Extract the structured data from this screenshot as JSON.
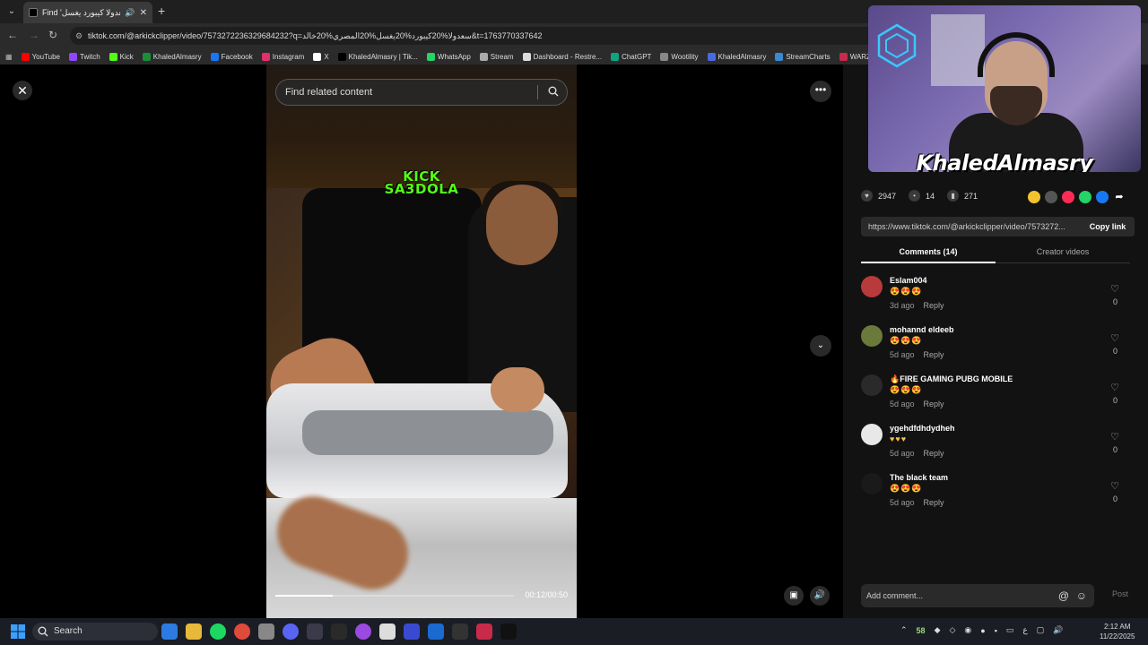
{
  "browser": {
    "tab_title": "Find 'سعدولا كيبورد يغسل",
    "url": "tiktok.com/@arkickclipper/video/7573272236329684232?q=سعدولا%20كيبورد%20يغسل%20المصري%20خالد&t=1763770337642",
    "bookmarks": [
      "YouTube",
      "Twitch",
      "Kick",
      "KhaledAlmasry",
      "Facebook",
      "Instagram",
      "X",
      "KhaledAlmasry | Tik...",
      "WhatsApp",
      "Stream",
      "Dashboard - Restre...",
      "ChatGPT",
      "Wootility",
      "KhaledAlmasry",
      "StreamCharts",
      "WARZ"
    ]
  },
  "search": {
    "placeholder": "Find related content"
  },
  "video": {
    "overlay_line1": "KICK",
    "overlay_line2": "SA3DOLA",
    "timecode": "00:12/00:50",
    "progress": 0.24
  },
  "stats": {
    "likes": "2947",
    "comments": "14",
    "saves": "271"
  },
  "link": {
    "url": "https://www.tiktok.com/@arkickclipper/video/7573272...",
    "copy_label": "Copy link"
  },
  "tabs": {
    "comments": "Comments (14)",
    "creator": "Creator videos"
  },
  "comments": [
    {
      "user": "Eslam004",
      "text": "😍😍😍",
      "age": "3d ago",
      "reply": "Reply",
      "likes": "0",
      "avatar_color": "#b83a3a"
    },
    {
      "user": "mohannd eldeeb",
      "text": "😍😍😍",
      "age": "5d ago",
      "reply": "Reply",
      "likes": "0",
      "avatar_color": "#6a7a3a"
    },
    {
      "user": "🔥FIRE GAMING PUBG MOBILE",
      "text": "😍😍😍",
      "age": "5d ago",
      "reply": "Reply",
      "likes": "0",
      "avatar_color": "#2a2a2a"
    },
    {
      "user": "ygehdfdhdydheh",
      "text": "♥♥♥",
      "age": "5d ago",
      "reply": "Reply",
      "likes": "0",
      "avatar_color": "#e8e8e8"
    },
    {
      "user": "The black team",
      "text": "😍😍😍",
      "age": "5d ago",
      "reply": "Reply",
      "likes": "0",
      "avatar_color": "#1a1a1a"
    }
  ],
  "add_comment": {
    "placeholder": "Add comment...",
    "post_label": "Post"
  },
  "webcam": {
    "name": "KhaledAlmasry"
  },
  "taskbar": {
    "search_label": "Search",
    "tray_num": "58",
    "time": "2:12 AM",
    "date": "11/22/2025"
  }
}
